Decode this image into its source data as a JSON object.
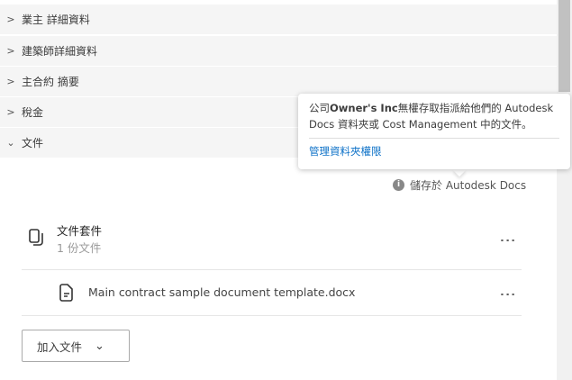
{
  "sections": [
    {
      "label": "業主 詳細資料",
      "expanded": false
    },
    {
      "label": "建築師詳細資料",
      "expanded": false
    },
    {
      "label": "主合約 摘要",
      "expanded": false
    },
    {
      "label": "稅金",
      "expanded": false
    },
    {
      "label": "文件",
      "expanded": true
    }
  ],
  "tooltip": {
    "prefix": "公司",
    "company": "Owner's Inc",
    "message": "無權存取指派給他們的 Autodesk Docs 資料夾或 Cost Management 中的文件。",
    "link": "管理資料夾權限"
  },
  "stored_in": "儲存於 Autodesk Docs",
  "document_set": {
    "title": "文件套件",
    "count": "1 份文件"
  },
  "document": {
    "name": "Main contract sample document template.docx"
  },
  "add_button": "加入文件"
}
